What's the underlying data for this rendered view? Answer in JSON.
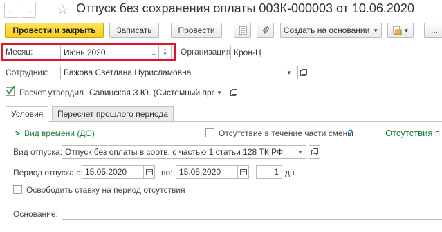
{
  "header": {
    "title": "Отпуск без сохранения оплаты 003К-000003 от 10.06.2020",
    "back_icon": "arrow-left-icon",
    "forward_icon": "arrow-right-icon",
    "star_icon": "star-icon"
  },
  "toolbar": {
    "post_close_label": "Провести и закрыть",
    "save_label": "Записать",
    "post_label": "Провести",
    "create_basis_label": "Создать на основании",
    "more_label": "..."
  },
  "form": {
    "month_label": "Месяц:",
    "month_value": "Июнь 2020",
    "org_label": "Организация:",
    "org_value": "Крон-Ц",
    "employee_label": "Сотрудник:",
    "employee_value": "Бажова Светлана Нурисламовна",
    "approved_label": "Расчет утвердил",
    "approved_checked": true,
    "approved_value": "Савинская З.Ю. (Системный прогр"
  },
  "tabs": [
    {
      "label": "Условия",
      "active": true
    },
    {
      "label": "Пересчет прошлого периода",
      "active": false
    }
  ],
  "conditions": {
    "time_type_label": "Вид времени (ДО)",
    "partial_absence_label": "Отсутствие в течение части смены",
    "help_mark": "?",
    "absences_link": "Отсутствия п",
    "leave_type_label": "Вид отпуска:",
    "leave_type_value": "Отпуск без оплаты в соотв. с частью 1 статьи 128 ТК РФ",
    "period_label": "Период отпуска с:",
    "date_from": "15.05.2020",
    "to_label": "по:",
    "date_to": "15.05.2020",
    "days_value": "1",
    "days_unit": "дн.",
    "free_rate_label": "Освободить ставку на период отсутствия",
    "basis_label": "Основание:",
    "basis_value": ""
  },
  "colors": {
    "primary_button": "#f8cf1a",
    "highlight_border": "#e0141e",
    "link_green": "#1d7d3a"
  }
}
